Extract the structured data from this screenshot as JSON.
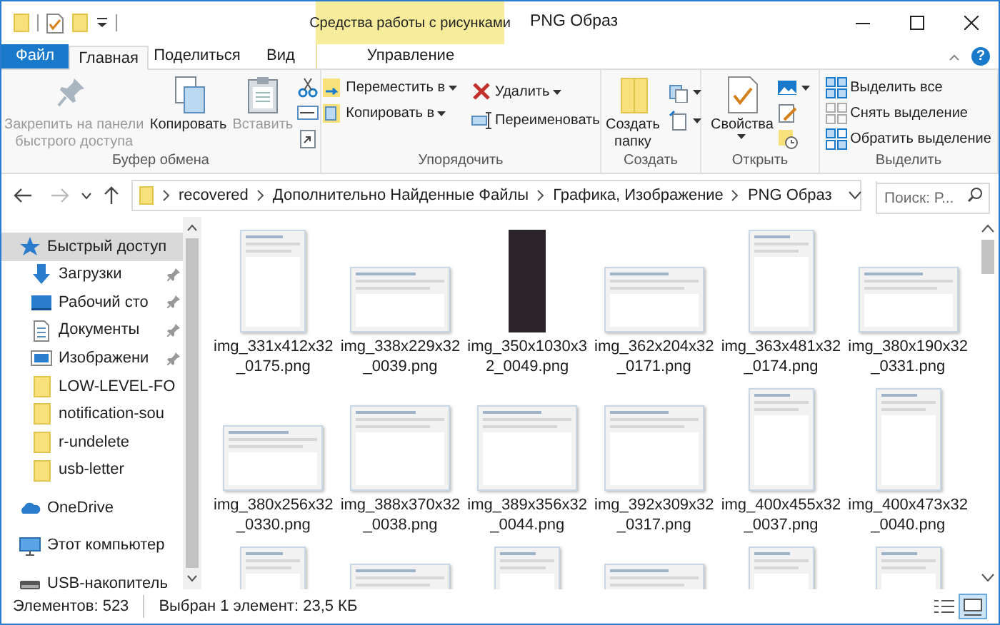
{
  "title_bar": {
    "contextual_header": "Средства работы с рисунками",
    "title": "PNG Образ"
  },
  "tabs": [
    {
      "label": "Файл",
      "kind": "file",
      "selected": false
    },
    {
      "label": "Главная",
      "kind": "plain",
      "selected": true
    },
    {
      "label": "Поделиться",
      "kind": "plain",
      "selected": false
    },
    {
      "label": "Вид",
      "kind": "plain",
      "selected": false
    },
    {
      "label": "Управление",
      "kind": "contextual",
      "selected": false
    }
  ],
  "help_button": "?",
  "ribbon": {
    "groups": [
      {
        "label": "Буфер обмена",
        "buttons": [
          {
            "kind": "large",
            "label": "Закрепить на панели быстрого доступа",
            "disabled": true
          },
          {
            "kind": "large",
            "label": "Копировать",
            "disabled": false
          },
          {
            "kind": "large",
            "label": "Вставить",
            "disabled": true
          },
          {
            "kind": "icon"
          },
          {
            "kind": "icon"
          },
          {
            "kind": "icon"
          }
        ]
      },
      {
        "label": "Упорядочить",
        "buttons": [
          {
            "kind": "small",
            "label": "Переместить в",
            "dropdown": true
          },
          {
            "kind": "small",
            "label": "Копировать в",
            "dropdown": true
          },
          {
            "kind": "break"
          },
          {
            "kind": "small",
            "label": "Удалить",
            "dropdown": true
          },
          {
            "kind": "small",
            "label": "Переименовать"
          }
        ]
      },
      {
        "label": "Создать",
        "buttons": [
          {
            "kind": "large",
            "label": "Создать папку",
            "disabled": false
          },
          {
            "kind": "icon",
            "dropdown": true
          },
          {
            "kind": "icon",
            "dropdown": true
          }
        ]
      },
      {
        "label": "Открыть",
        "buttons": [
          {
            "kind": "large",
            "label": "Свойства",
            "dropdown": true,
            "disabled": false
          },
          {
            "kind": "icon",
            "dropdown": true
          },
          {
            "kind": "icon"
          },
          {
            "kind": "icon"
          }
        ]
      },
      {
        "label": "Выделить",
        "buttons": [
          {
            "kind": "small",
            "label": "Выделить все"
          },
          {
            "kind": "small",
            "label": "Снять выделение"
          },
          {
            "kind": "small",
            "label": "Обратить выделение"
          }
        ]
      }
    ]
  },
  "address_bar": {
    "path": [
      "recovered",
      "Дополнительно Найденные Файлы",
      "Графика, Изображение",
      "PNG Образ"
    ],
    "search_placeholder": "Поиск: Р..."
  },
  "navigation": [
    {
      "label": "Быстрый доступ",
      "kind": "star",
      "selected": true,
      "children": [
        {
          "label": "Загрузки",
          "kind": "download",
          "pinned": true,
          "selected": false
        },
        {
          "label": "Рабочий сто",
          "kind": "desktop",
          "pinned": true,
          "selected": false
        },
        {
          "label": "Документы",
          "kind": "documents",
          "pinned": true,
          "selected": false
        },
        {
          "label": "Изображени",
          "kind": "pictures",
          "pinned": true,
          "selected": false
        },
        {
          "label": "LOW-LEVEL-FO",
          "kind": "folder",
          "pinned": false,
          "selected": false
        },
        {
          "label": "notification-sou",
          "kind": "folder",
          "pinned": false,
          "selected": false
        },
        {
          "label": "r-undelete",
          "kind": "folder",
          "pinned": false,
          "selected": false
        },
        {
          "label": "usb-letter",
          "kind": "folder",
          "pinned": false,
          "selected": false
        }
      ]
    },
    {
      "label": "OneDrive",
      "kind": "cloud",
      "selected": false
    },
    {
      "label": "Этот компьютер",
      "kind": "computer",
      "selected": false
    },
    {
      "label": "USB-накопитель",
      "kind": "drive",
      "selected": false
    }
  ],
  "files": [
    {
      "name": "img_331x412x32_0175.png",
      "kind": "tall"
    },
    {
      "name": "img_338x229x32_0039.png",
      "kind": "wide"
    },
    {
      "name": "img_350x1030x32_0049.png",
      "kind": "dark"
    },
    {
      "name": "img_362x204x32_0171.png",
      "kind": "wide"
    },
    {
      "name": "img_363x481x32_0174.png",
      "kind": "tall"
    },
    {
      "name": "img_380x190x32_0331.png",
      "kind": "wide"
    },
    {
      "name": "img_380x256x32_0330.png",
      "kind": "wide"
    },
    {
      "name": "img_388x370x32_0038.png",
      "kind": "square"
    },
    {
      "name": "img_389x356x32_0044.png",
      "kind": "square"
    },
    {
      "name": "img_392x309x32_0317.png",
      "kind": "square"
    },
    {
      "name": "img_400x455x32_0037.png",
      "kind": "tall"
    },
    {
      "name": "img_400x473x32_0040.png",
      "kind": "tall"
    },
    {
      "kind": "tall"
    },
    {
      "kind": "square"
    },
    {
      "kind": "tall"
    },
    {
      "kind": "square"
    },
    {
      "kind": "tall"
    },
    {
      "kind": "tall"
    }
  ],
  "status_bar": {
    "item_count": "Элементов: 523",
    "selection": "Выбран 1 элемент: 23,5 КБ",
    "views": [
      {
        "kind": "details",
        "selected": false
      },
      {
        "kind": "large-icons",
        "selected": true
      }
    ]
  }
}
